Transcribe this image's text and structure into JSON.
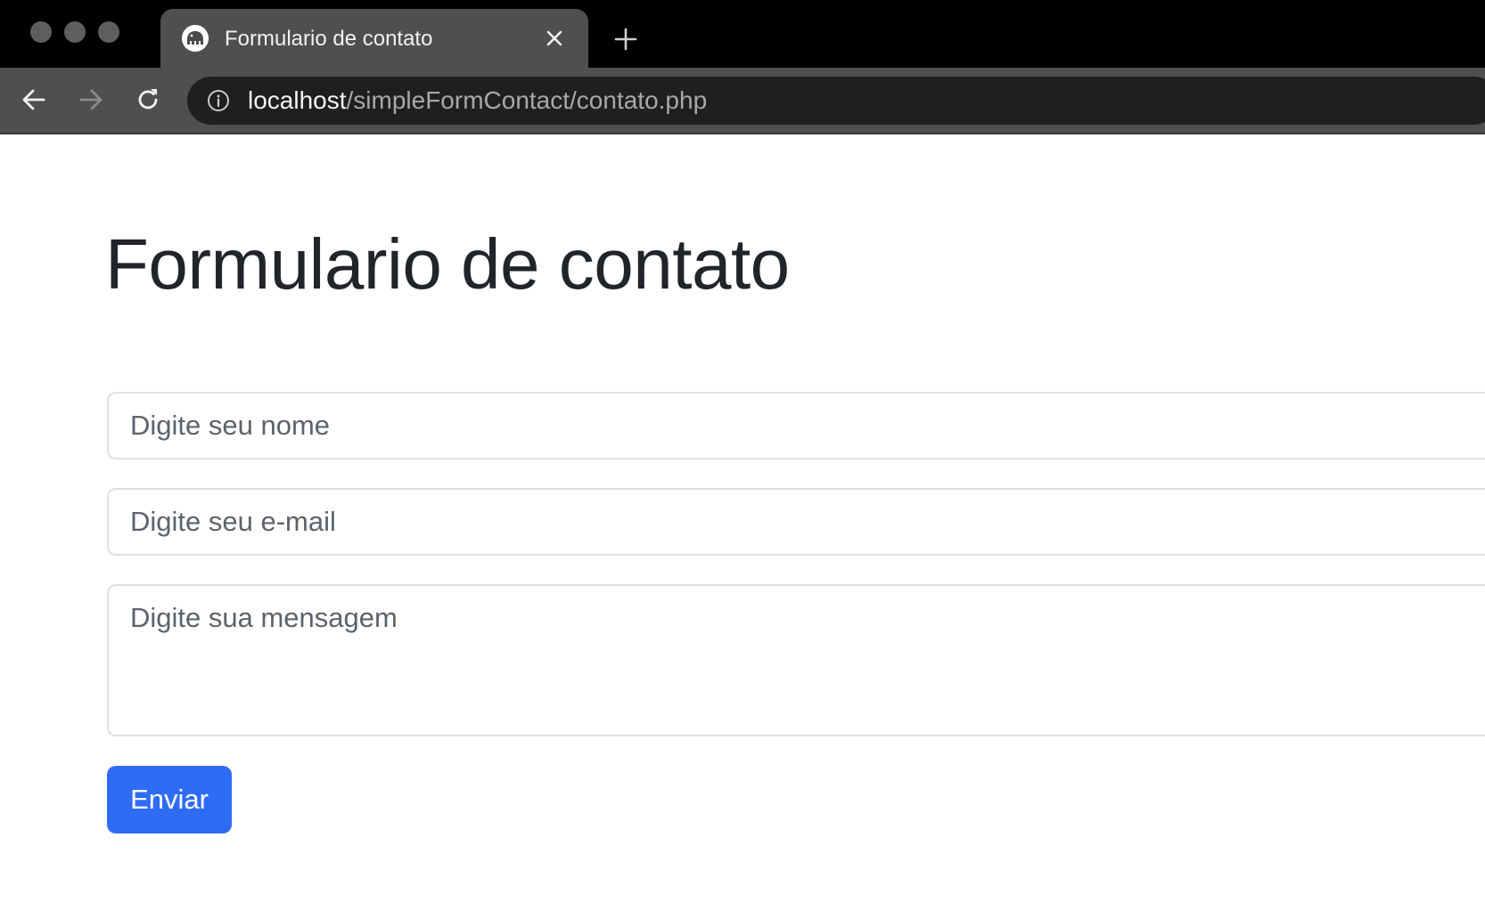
{
  "browser": {
    "tab": {
      "title": "Formulario de contato",
      "favicon": "elephant-favicon-icon"
    },
    "address_bar": {
      "host": "localhost",
      "path": "/simpleFormContact/contato.php"
    },
    "icons": {
      "back": "arrow-left-icon",
      "forward": "arrow-right-icon",
      "reload": "reload-icon",
      "site_info": "info-icon",
      "close_tab": "close-icon",
      "new_tab": "plus-icon"
    },
    "colors": {
      "frame": "#000000",
      "toolbar": "#4f4f52",
      "omnibox": "#1f1f1f"
    }
  },
  "page": {
    "title": "Formulario de contato",
    "form": {
      "name_placeholder": "Digite seu nome",
      "email_placeholder": "Digite seu e-mail",
      "message_placeholder": "Digite sua mensagem",
      "submit_label": "Enviar"
    },
    "colors": {
      "primary": "#2f6cf5",
      "text": "#212529",
      "border": "#dee2e6"
    }
  }
}
